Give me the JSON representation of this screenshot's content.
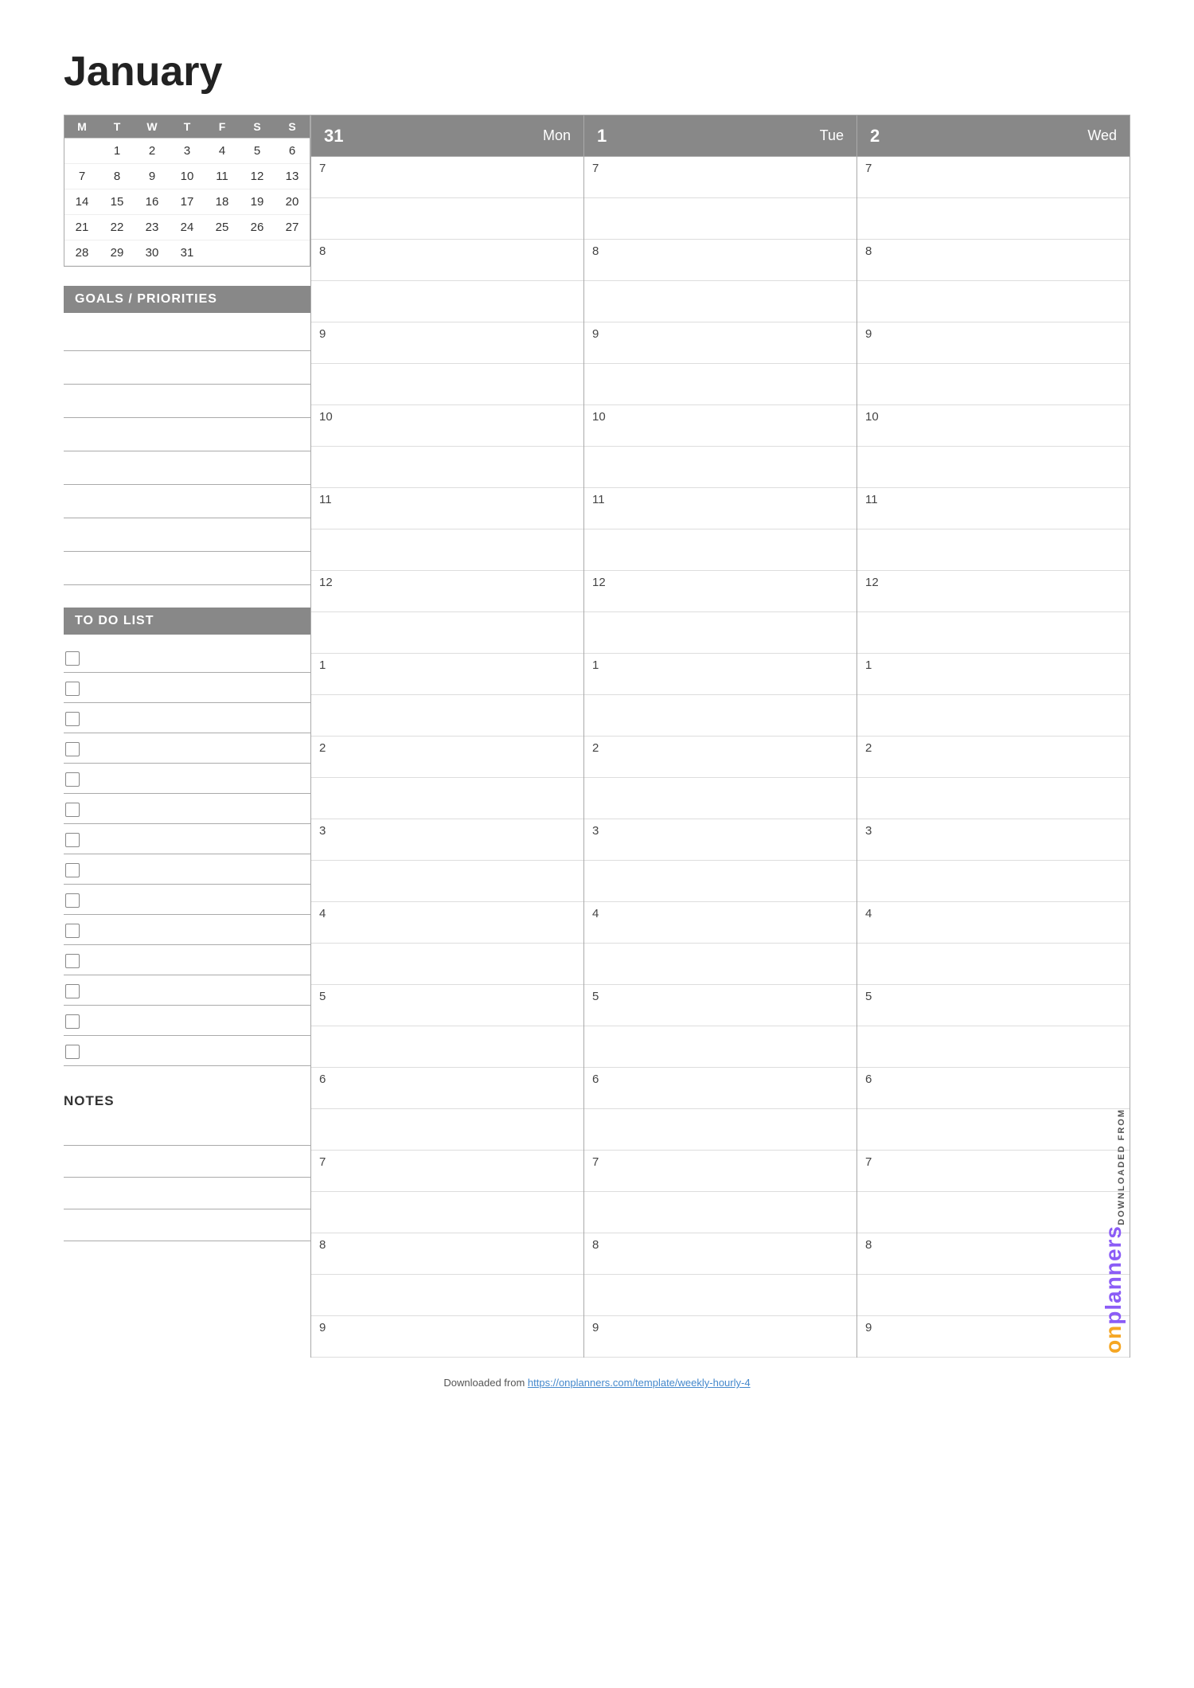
{
  "page": {
    "title": "January"
  },
  "mini_calendar": {
    "headers": [
      "M",
      "T",
      "W",
      "T",
      "F",
      "S",
      "S"
    ],
    "rows": [
      [
        "",
        "1",
        "2",
        "3",
        "4",
        "5",
        "6"
      ],
      [
        "7",
        "8",
        "9",
        "10",
        "11",
        "12",
        "13"
      ],
      [
        "14",
        "15",
        "16",
        "17",
        "18",
        "19",
        "20"
      ],
      [
        "21",
        "22",
        "23",
        "24",
        "25",
        "26",
        "27"
      ],
      [
        "28",
        "29",
        "30",
        "31",
        "",
        "",
        ""
      ]
    ]
  },
  "goals": {
    "header": "GOALS / PRIORITIES",
    "lines": 8
  },
  "todo": {
    "header": "TO DO LIST",
    "items": 14
  },
  "notes": {
    "label": "NOTES",
    "lines": 4
  },
  "days": [
    {
      "num": "31",
      "name": "Mon"
    },
    {
      "num": "1",
      "name": "Tue"
    },
    {
      "num": "2",
      "name": "Wed"
    }
  ],
  "hours": [
    "7",
    "",
    "8",
    "",
    "9",
    "",
    "10",
    "",
    "11",
    "",
    "12",
    "",
    "1",
    "",
    "2",
    "",
    "3",
    "",
    "4",
    "",
    "5",
    "",
    "6",
    "",
    "7",
    "",
    "8",
    "",
    "9"
  ],
  "hours_labeled": [
    {
      "label": "7"
    },
    {
      "label": ""
    },
    {
      "label": "8"
    },
    {
      "label": ""
    },
    {
      "label": "9"
    },
    {
      "label": ""
    },
    {
      "label": "10"
    },
    {
      "label": ""
    },
    {
      "label": "11"
    },
    {
      "label": ""
    },
    {
      "label": "12"
    },
    {
      "label": ""
    },
    {
      "label": "1"
    },
    {
      "label": ""
    },
    {
      "label": "2"
    },
    {
      "label": ""
    },
    {
      "label": "3"
    },
    {
      "label": ""
    },
    {
      "label": "4"
    },
    {
      "label": ""
    },
    {
      "label": "5"
    },
    {
      "label": ""
    },
    {
      "label": "6"
    },
    {
      "label": ""
    },
    {
      "label": "7"
    },
    {
      "label": ""
    },
    {
      "label": "8"
    },
    {
      "label": ""
    },
    {
      "label": "9"
    }
  ],
  "brand": {
    "downloaded_from": "DOWNLOADED FROM",
    "on": "on",
    "planners": "planners"
  },
  "footer": {
    "text": "Downloaded from ",
    "link_text": "https://onplanners.com/template/weekly-hourly-4",
    "link_href": "https://onplanners.com/template/weekly-hourly-4"
  }
}
